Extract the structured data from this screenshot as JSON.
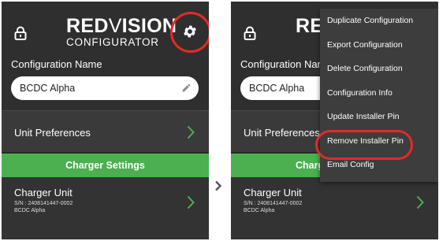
{
  "app": {
    "logo_brand_bold": "RED",
    "logo_brand_v": "V",
    "logo_brand_rest": "ISION",
    "logo_subtitle": "CONFIGURATOR"
  },
  "icons": {
    "lock": "lock-icon",
    "settings": "gear-icon",
    "edit": "pencil-icon",
    "chevron": "chevron-right-icon",
    "step_arrow": "chevron-right-icon"
  },
  "colors": {
    "accent_green": "#4caf50",
    "highlight_red": "#e32b25",
    "background_dark": "#2e2e2e"
  },
  "left_screen": {
    "config_label": "Configuration Name",
    "config_value": "BCDC Alpha",
    "unit_preferences": "Unit Preferences",
    "charger_settings": "Charger Settings",
    "charger_unit": {
      "title": "Charger Unit",
      "serial": "S/N : 2408141447-0002",
      "name": "BCDC Alpha"
    }
  },
  "right_screen": {
    "logo_partial": "RED",
    "config_label": "Configuration Name",
    "config_value": "BCDC Alpha",
    "unit_preferences": "Unit Preferences",
    "charger_settings_partial": "Charg",
    "charger_unit": {
      "title": "Charger Unit",
      "serial": "S/N : 2408141447-0002",
      "name": "BCDC Alpha"
    },
    "menu": {
      "items": [
        "Duplicate Configuration",
        "Export Configuration",
        "Delete Configuration",
        "Configuration Info",
        "Update Installer Pin",
        "Remove Installer Pin",
        "Email Config"
      ],
      "highlighted": "Remove Installer Pin"
    }
  }
}
